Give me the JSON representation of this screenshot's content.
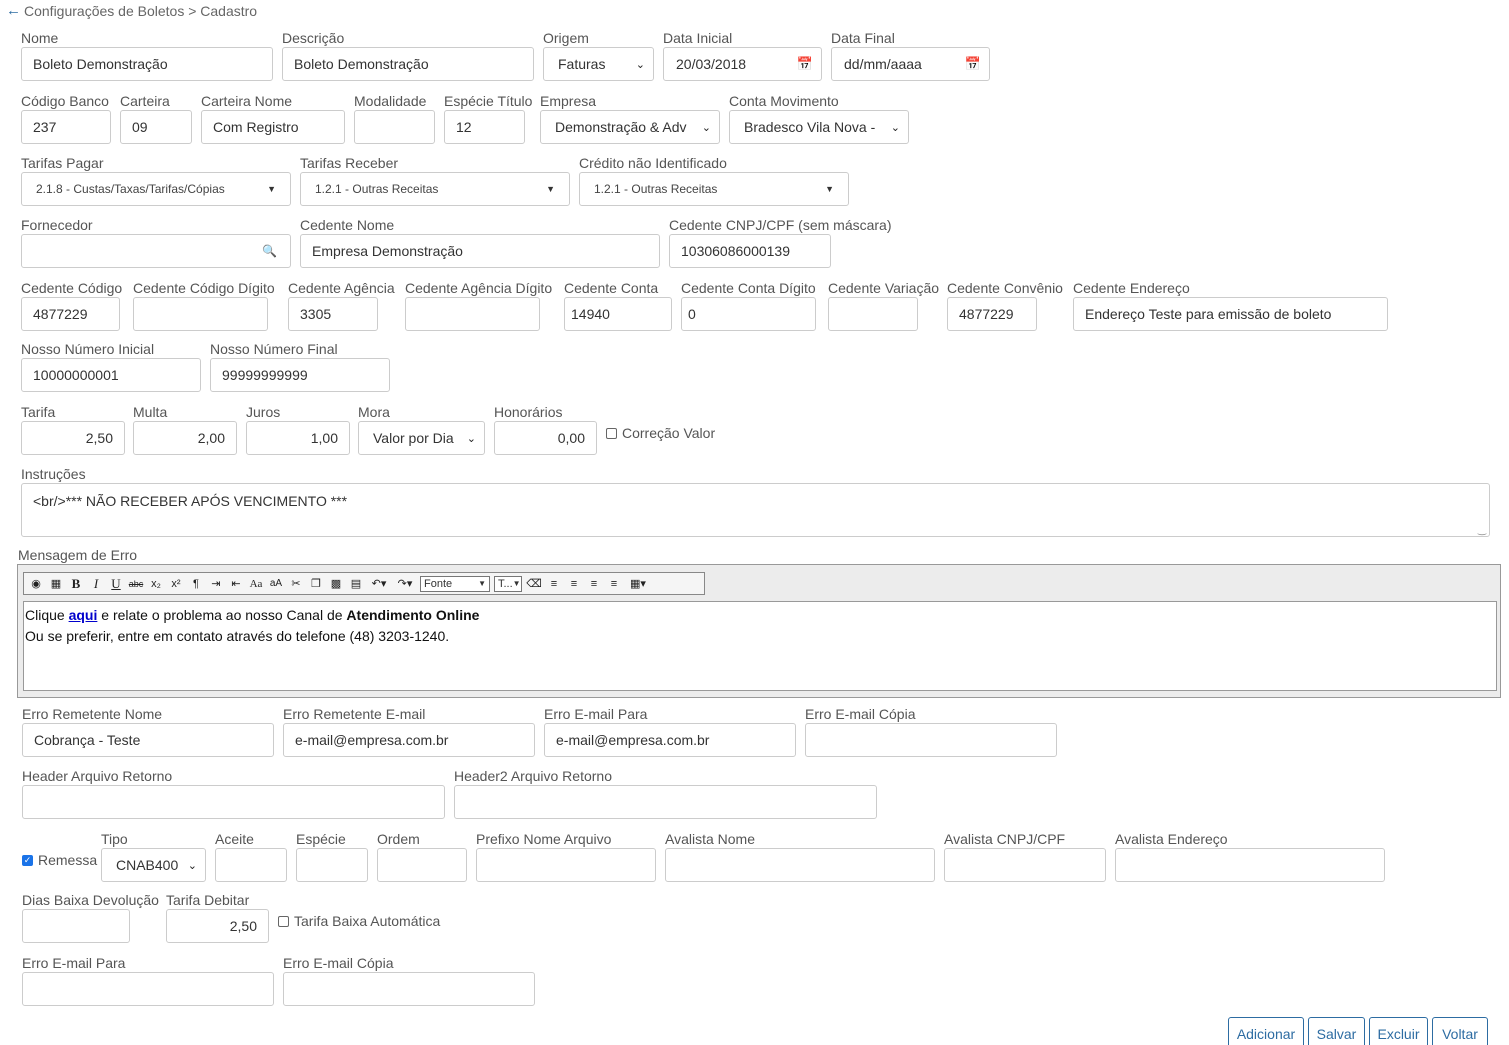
{
  "breadcrumb": "Configurações de Boletos > Cadastro",
  "labels": {
    "nome": "Nome",
    "descricao": "Descrição",
    "origem": "Origem",
    "data_inicial": "Data Inicial",
    "data_final": "Data Final",
    "codigo_banco": "Código Banco",
    "carteira": "Carteira",
    "carteira_nome": "Carteira Nome",
    "modalidade": "Modalidade",
    "especie_titulo": "Espécie Título",
    "empresa": "Empresa",
    "conta_movimento": "Conta Movimento",
    "tarifas_pagar": "Tarifas Pagar",
    "tarifas_receber": "Tarifas Receber",
    "credito_nao_identificado": "Crédito não Identificado",
    "fornecedor": "Fornecedor",
    "cedente_nome": "Cedente Nome",
    "cedente_cnpj": "Cedente CNPJ/CPF (sem máscara)",
    "cedente_codigo": "Cedente Código",
    "cedente_codigo_digito": "Cedente Código Dígito",
    "cedente_agencia": "Cedente Agência",
    "cedente_agencia_digito": "Cedente Agência Dígito",
    "cedente_conta": "Cedente Conta",
    "cedente_conta_digito": "Cedente Conta Dígito",
    "cedente_variacao": "Cedente Variação",
    "cedente_convenio": "Cedente Convênio",
    "cedente_endereco": "Cedente Endereço",
    "nosso_numero_inicial": "Nosso Número Inicial",
    "nosso_numero_final": "Nosso Número Final",
    "tarifa": "Tarifa",
    "multa": "Multa",
    "juros": "Juros",
    "mora": "Mora",
    "honorarios": "Honorários",
    "correcao_valor": "Correção Valor",
    "instrucoes": "Instruções",
    "mensagem_erro": "Mensagem de Erro",
    "erro_remetente_nome": "Erro Remetente Nome",
    "erro_remetente_email": "Erro Remetente E-mail",
    "erro_email_para": "Erro E-mail Para",
    "erro_email_copia": "Erro E-mail Cópia",
    "header_arquivo_retorno": "Header Arquivo Retorno",
    "header2_arquivo_retorno": "Header2 Arquivo Retorno",
    "remessa": "Remessa",
    "tipo": "Tipo",
    "aceite": "Aceite",
    "especie": "Espécie",
    "ordem": "Ordem",
    "prefixo_nome_arquivo": "Prefixo Nome Arquivo",
    "avalista_nome": "Avalista Nome",
    "avalista_cnpj": "Avalista CNPJ/CPF",
    "avalista_endereco": "Avalista Endereço",
    "dias_baixa_devolucao": "Dias Baixa Devolução",
    "tarifa_debitar": "Tarifa Debitar",
    "tarifa_baixa_automatica": "Tarifa Baixa Automática",
    "erro_email_para_2": "Erro E-mail Para",
    "erro_email_copia_2": "Erro E-mail Cópia"
  },
  "values": {
    "nome": "Boleto Demonstração",
    "descricao": "Boleto Demonstração",
    "origem": "Faturas",
    "data_inicial": "20/03/2018",
    "data_final": "dd/mm/aaaa",
    "codigo_banco": "237",
    "carteira": "09",
    "carteira_nome": "Com Registro",
    "modalidade": "",
    "especie_titulo": "12",
    "empresa": "Demonstração & Adv",
    "conta_movimento": "Bradesco Vila Nova -",
    "tarifas_pagar": "2.1.8 - Custas/Taxas/Tarifas/Cópias",
    "tarifas_receber": "1.2.1 - Outras Receitas",
    "credito_nao_identificado": "1.2.1 - Outras Receitas",
    "fornecedor": "",
    "cedente_nome": "Empresa Demonstração",
    "cedente_cnpj": "10306086000139",
    "cedente_codigo": "4877229",
    "cedente_codigo_digito": "",
    "cedente_agencia": "3305",
    "cedente_agencia_digito": "",
    "cedente_conta": "14940",
    "cedente_conta_digito": "0",
    "cedente_variacao": "",
    "cedente_convenio": "4877229",
    "cedente_endereco": "Endereço Teste para emissão de boleto",
    "nosso_numero_inicial": "10000000001",
    "nosso_numero_final": "99999999999",
    "tarifa": "2,50",
    "multa": "2,00",
    "juros": "1,00",
    "mora": "Valor por Dia",
    "honorarios": "0,00",
    "instrucoes": "<br/>*** NÃO RECEBER APÓS VENCIMENTO ***",
    "erro_remetente_nome": "Cobrança - Teste",
    "erro_remetente_email": "e-mail@empresa.com.br",
    "erro_email_para": "e-mail@empresa.com.br",
    "erro_email_copia": "",
    "tipo": "CNAB400",
    "tarifa_debitar": "2,50"
  },
  "editor": {
    "toolbar": {
      "fonte": "Fonte",
      "tamanho": "T..."
    },
    "line1_a": "Clique ",
    "line1_link": "aqui",
    "line1_b": " e relate o problema ao nosso Canal de ",
    "line1_bold": "Atendimento Online",
    "line2": "Ou se preferir, entre em contato através do telefone (48) 3203-1240."
  },
  "checkboxes": {
    "correcao_valor": false,
    "remessa": true,
    "tarifa_baixa_automatica": false
  },
  "buttons": {
    "adicionar": "Adicionar",
    "salvar": "Salvar",
    "excluir": "Excluir",
    "voltar": "Voltar"
  },
  "colors": {
    "accent": "#2d6ca2",
    "link": "#0000cc",
    "check": "#1a73e8"
  }
}
